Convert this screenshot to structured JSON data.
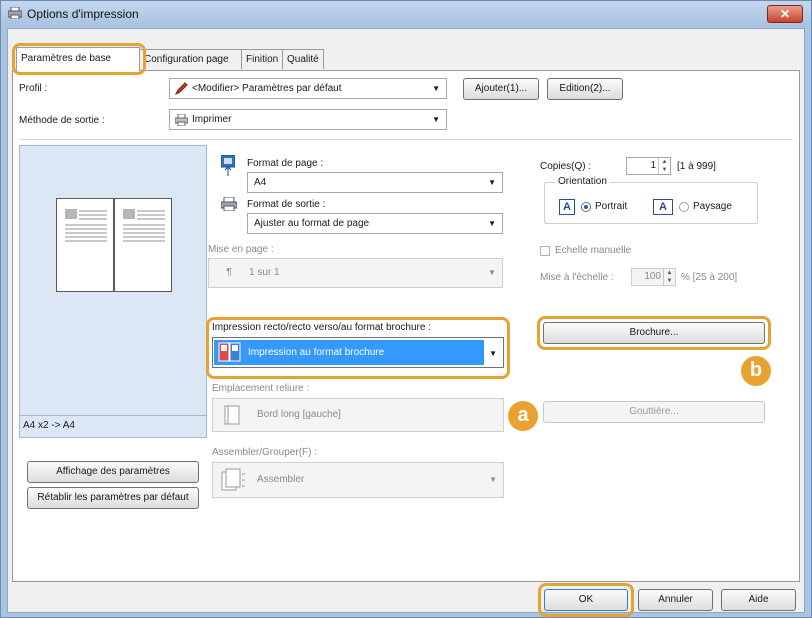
{
  "window": {
    "title": "Options d'impression",
    "close_label": "✕"
  },
  "tabs": [
    {
      "label": "Paramètres de base"
    },
    {
      "label": "Configuration page"
    },
    {
      "label": "Finition"
    },
    {
      "label": "Qualité"
    }
  ],
  "profile": {
    "label": "Profil :",
    "value": "<Modifier> Paramètres par défaut",
    "add_button": "Ajouter(1)...",
    "edit_button": "Edition(2)..."
  },
  "output": {
    "label": "Méthode de sortie :",
    "value": "Imprimer"
  },
  "page_size": {
    "label": "Format de page :",
    "value": "A4"
  },
  "output_size": {
    "label": "Format de sortie :",
    "value": "Ajuster au format de page"
  },
  "layout": {
    "label": "Mise en page :",
    "value": "1 sur 1"
  },
  "duplex": {
    "label": "Impression recto/recto verso/au format brochure :",
    "value": "Impression au format brochure"
  },
  "binding": {
    "label": "Emplacement reliure :",
    "value": "Bord long [gauche]"
  },
  "collate": {
    "label": "Assembler/Grouper(F) :",
    "value": "Assembler"
  },
  "copies": {
    "label": "Copies(Q) :",
    "value": "1",
    "range": "[1 à 999]"
  },
  "orientation": {
    "label": "Orientation",
    "portrait": "Portrait",
    "landscape": "Paysage",
    "portrait_icon": "A",
    "landscape_icon": "A"
  },
  "manual_scale": {
    "label": "Echelle manuelle",
    "scale_label": "Mise à l'échelle :",
    "value": "100",
    "range": "% [25 à 200]"
  },
  "buttons": {
    "brochure": "Brochure...",
    "gutter": "Gouttière...",
    "show_settings": "Affichage des paramètres",
    "restore_defaults": "Rétablir les paramètres par défaut",
    "ok": "OK",
    "cancel": "Annuler",
    "help": "Aide"
  },
  "preview": {
    "caption": "A4 x2 -> A4"
  },
  "callouts": {
    "a": "a",
    "b": "b"
  },
  "colors": {
    "highlight": "#e8a231",
    "selection": "#3399ff",
    "preview_bg": "#dbe7f5"
  }
}
